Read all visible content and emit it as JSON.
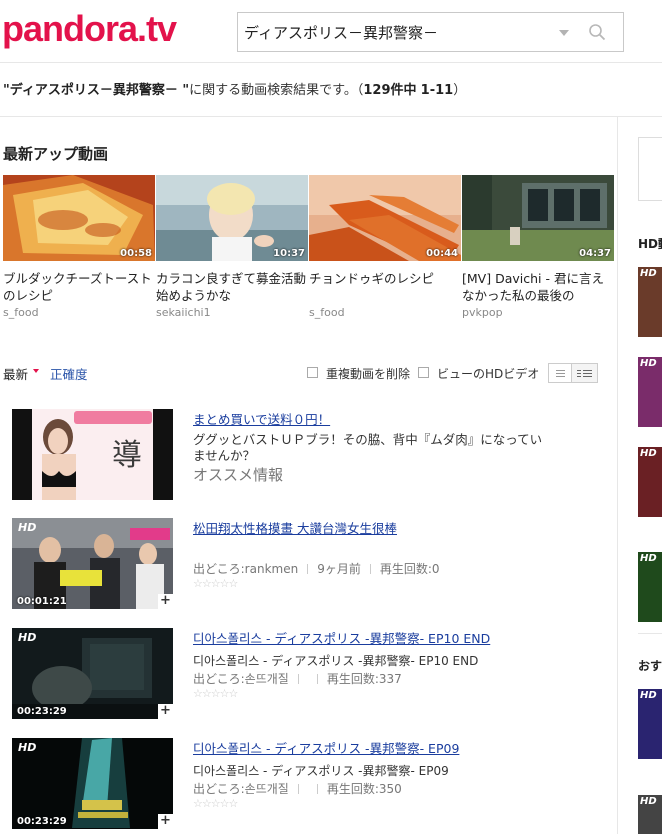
{
  "brand": {
    "logo": "pandora.tv"
  },
  "search": {
    "value": "ディアスポリス－異邦警察－"
  },
  "result": {
    "query": "\"ディアスポリス－異邦警察－ \"",
    "suffix": "に関する動画検索結果です。（",
    "total": "129件中",
    "range": "1-11",
    "close": "）"
  },
  "latest": {
    "title": "最新アップ動画",
    "cards": [
      {
        "duration": "00:58",
        "title": "ブルダックチーズトーストのレシピ",
        "author": "s_food"
      },
      {
        "duration": "10:37",
        "title": "カラコン良すぎて募金活動始めようかな",
        "author": "sekaiichi1"
      },
      {
        "duration": "00:44",
        "title": "チョンドゥギのレシピ",
        "author": "s_food"
      },
      {
        "duration": "04:37",
        "title": "[MV] Davichi - 君に言えなかった私の最後の",
        "author": "pvkpop"
      }
    ]
  },
  "sort": {
    "newest": "最新",
    "accuracy": "正確度",
    "dedupe_label": "重複動画を削除",
    "hd_label": "ビューのHDビデオ"
  },
  "ad": {
    "title": "まとめ買いで送料０円！",
    "desc": "ググッとバストＵＰブラ！その脇、背中『ムダ肉』になっていませんか？",
    "tag": "オススメ情報"
  },
  "results": [
    {
      "hd": "HD",
      "duration": "00:01:21",
      "title": "松田翔太性格摸畫 大讚台灣女生很棒",
      "desc": "",
      "source": "出どころ:rankmen",
      "age": "9ヶ月前",
      "views": "再生回数:0"
    },
    {
      "hd": "HD",
      "duration": "00:23:29",
      "title": "디아스폴리스 - ディアスポリス -異邦警察- EP10 END",
      "desc": "디아스폴리스 - ディアスポリス -異邦警察- EP10 END",
      "source": "出どころ:손뜨개질",
      "age": "",
      "views": "再生回数:337"
    },
    {
      "hd": "HD",
      "duration": "00:23:29",
      "title": "디아스폴리스 - ディアスポリス -異邦警察- EP09",
      "desc": "디아스폴리스 - ディアスポリス -異邦警察- EP09",
      "source": "出どころ:손뜨개질",
      "age": "",
      "views": "再生回数:350"
    }
  ],
  "ratings": [
    "☆☆☆☆☆",
    "☆☆☆☆☆",
    "☆☆☆☆☆"
  ],
  "side": {
    "hd_label": "HD動",
    "osu_label": "おす",
    "thumb_hd": "HD"
  },
  "colors": {
    "brand": "#e3124b",
    "link": "#1a3d9e",
    "sort_link": "#2953a8"
  }
}
